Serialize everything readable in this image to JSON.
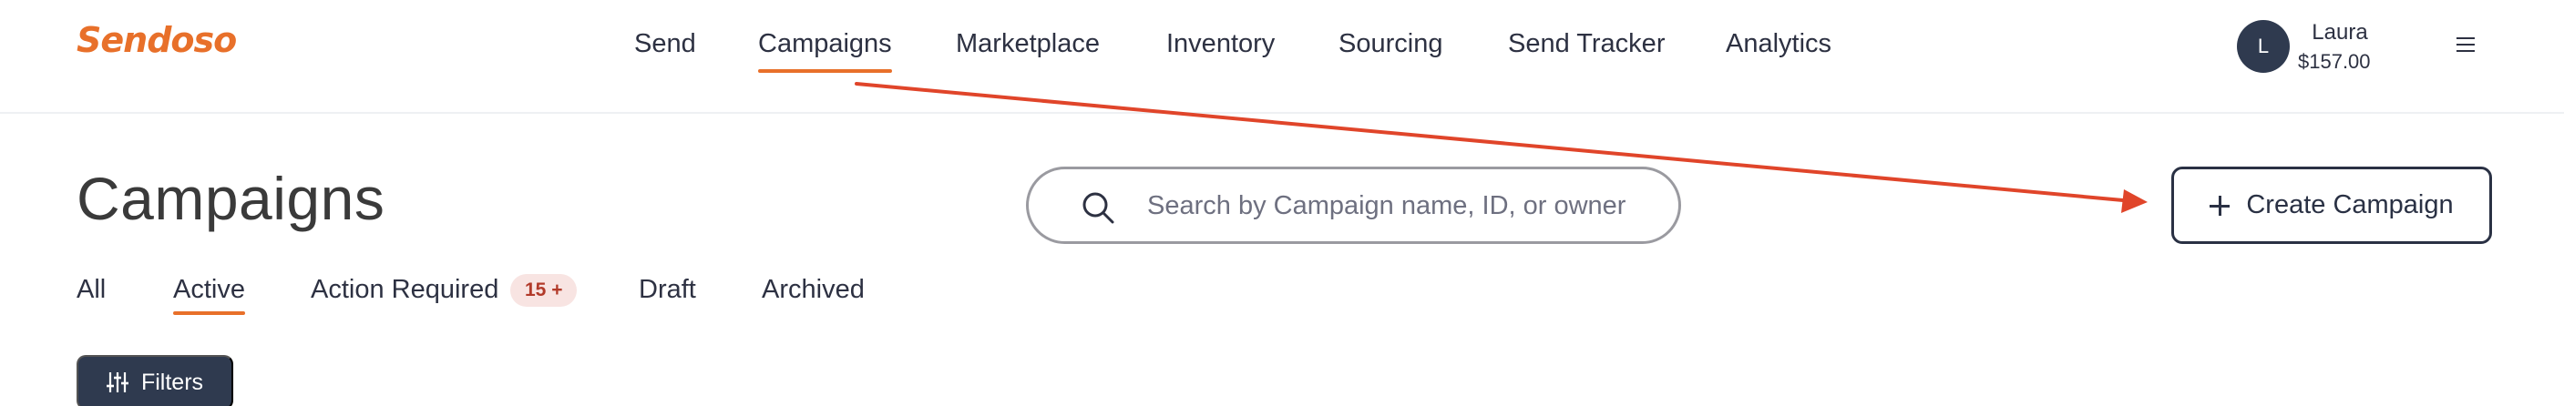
{
  "header": {
    "logo_text": "Sendoso",
    "nav": [
      {
        "label": "Send"
      },
      {
        "label": "Campaigns",
        "active": true
      },
      {
        "label": "Marketplace"
      },
      {
        "label": "Inventory"
      },
      {
        "label": "Sourcing"
      },
      {
        "label": "Send Tracker"
      },
      {
        "label": "Analytics"
      }
    ],
    "user": {
      "initial": "L",
      "name": "Laura",
      "balance": "$157.00"
    },
    "menu_icon": "hamburger-menu-icon"
  },
  "page": {
    "title": "Campaigns",
    "search": {
      "placeholder": "Search by Campaign name, ID, or owner",
      "value": "",
      "icon": "search-icon"
    },
    "create_button": {
      "label": "Create Campaign",
      "icon": "plus-icon"
    },
    "tabs": [
      {
        "label": "All"
      },
      {
        "label": "Active",
        "active": true
      },
      {
        "label": "Action Required",
        "badge": "15 +"
      },
      {
        "label": "Draft"
      },
      {
        "label": "Archived"
      }
    ],
    "filters_button": {
      "label": "Filters",
      "icon": "filter-sliders-icon"
    }
  },
  "colors": {
    "brand": "#e8702a",
    "dark": "#2f3a4f",
    "annotation_arrow": "#e0452a",
    "badge_bg": "#f8e4e2",
    "badge_text": "#b23a2a"
  }
}
